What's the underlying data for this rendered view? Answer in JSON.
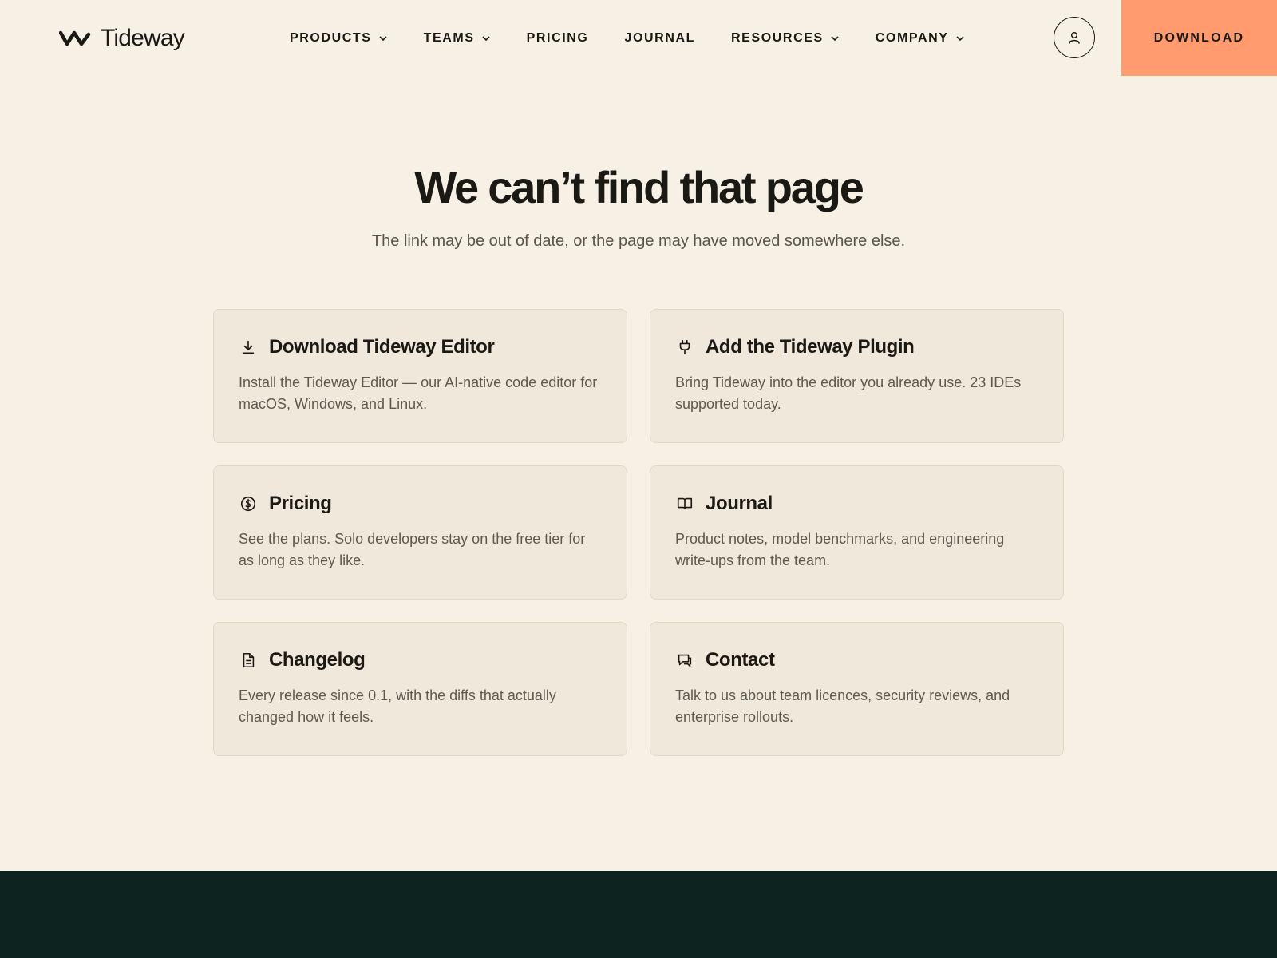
{
  "brand": {
    "name": "Tideway"
  },
  "nav": {
    "items": [
      {
        "label": "PRODUCTS",
        "dropdown": true
      },
      {
        "label": "TEAMS",
        "dropdown": true
      },
      {
        "label": "PRICING",
        "dropdown": false
      },
      {
        "label": "JOURNAL",
        "dropdown": false
      },
      {
        "label": "RESOURCES",
        "dropdown": true
      },
      {
        "label": "COMPANY",
        "dropdown": true
      }
    ]
  },
  "header": {
    "download_label": "DOWNLOAD",
    "account_icon": "user-icon"
  },
  "hero": {
    "title": "We can’t find that page",
    "subtitle": "The link may be out of date, or the page may have moved somewhere else."
  },
  "cards": [
    {
      "icon": "download-icon",
      "title": "Download Tideway Editor",
      "description": "Install the Tideway Editor — our AI-native code editor for macOS, Windows, and Linux."
    },
    {
      "icon": "plug-icon",
      "title": "Add the Tideway Plugin",
      "description": "Bring Tideway into the editor you already use. 23 IDEs supported today."
    },
    {
      "icon": "dollar-circle-icon",
      "title": "Pricing",
      "description": "See the plans. Solo developers stay on the free tier for as long as they like."
    },
    {
      "icon": "book-icon",
      "title": "Journal",
      "description": "Product notes, model benchmarks, and engineering write-ups from the team."
    },
    {
      "icon": "document-icon",
      "title": "Changelog",
      "description": "Every release since 0.1, with the diffs that actually changed how it feels."
    },
    {
      "icon": "chat-icon",
      "title": "Contact",
      "description": "Talk to us about team licences, security reviews, and enterprise rollouts."
    }
  ],
  "colors": {
    "background": "#f6f0e5",
    "accent": "#ff9b6e",
    "card_background": "#f0e8da",
    "footer": "#0c231f",
    "text": "#1b1913"
  }
}
